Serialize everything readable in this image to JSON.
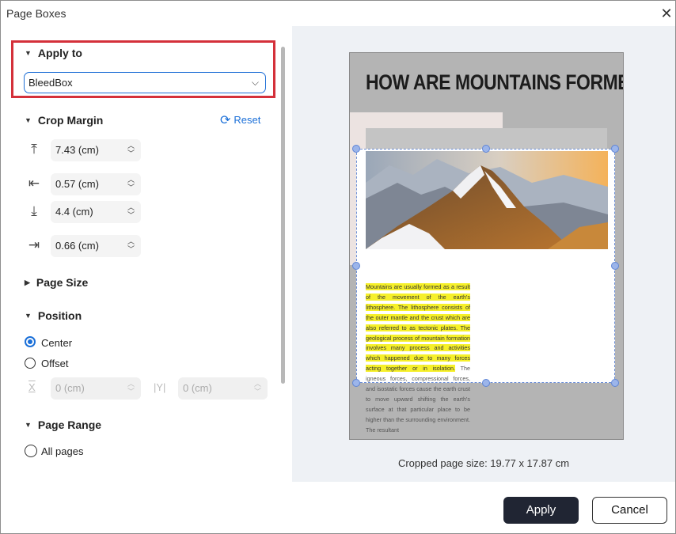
{
  "window": {
    "title": "Page Boxes",
    "close_glyph": "✕"
  },
  "apply_to": {
    "heading": "Apply to",
    "selected": "BleedBox",
    "highlight_color": "#d4303a"
  },
  "crop_margin": {
    "heading": "Crop Margin",
    "reset_label": "Reset",
    "top": "7.43 (cm)",
    "left": "0.57 (cm)",
    "bottom": "4.4 (cm)",
    "right": "0.66 (cm)"
  },
  "page_size": {
    "heading": "Page Size"
  },
  "position": {
    "heading": "Position",
    "center_label": "Center",
    "offset_label": "Offset",
    "x_label": "X",
    "y_label": "|Y|",
    "x_value": "0 (cm)",
    "y_value": "0 (cm)"
  },
  "page_range": {
    "heading": "Page Range",
    "all_pages_label": "All pages"
  },
  "preview": {
    "page_title": "HOW ARE MOUNTAINS FORMED?",
    "highlighted_text": "Mountains are usually formed as a result of the movement of the earth's lithosphere. The lithosphere consists of the outer mantle and the crust which are also referred to as tectonic plates. The geological process of mountain formation involves many process and activities which happened due to many forces acting together or in isolation.",
    "normal_text": " The igneous forces, compressional forces, and isostatic forces cause the earth crust to move upward shifting the earth's surface at that particular place to be higher than the surrounding environment. The resultant",
    "cropped_size_text": "Cropped page size: 19.77 x 17.87 cm"
  },
  "buttons": {
    "apply": "Apply",
    "cancel": "Cancel"
  },
  "colors": {
    "accent": "#1a6fd8",
    "primary_button": "#202533",
    "highlight": "#f6f02a"
  }
}
